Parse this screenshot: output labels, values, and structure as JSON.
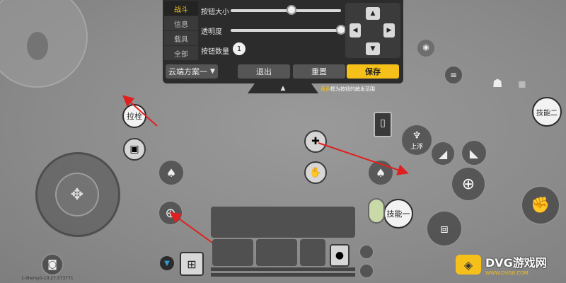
{
  "tabs": [
    {
      "label": "战斗",
      "active": true
    },
    {
      "label": "信息",
      "active": false
    },
    {
      "label": "载具",
      "active": false
    },
    {
      "label": "全部",
      "active": false
    }
  ],
  "settings": {
    "button_size_label": "按钮大小",
    "button_size_value": 0.55,
    "opacity_label": "透明度",
    "opacity_value": 1.0,
    "button_count_label": "按钮数量",
    "button_count_value": "1"
  },
  "scheme_select": "云端方案一",
  "actions": {
    "exit": "退出",
    "reset": "重置",
    "save": "保存"
  },
  "hint": {
    "highlight": "黄色",
    "rest": "框为按钮的触发范围"
  },
  "buttons": {
    "pull_bolt": "拉栓",
    "skill_two": "技能二",
    "skill_one": "技能一",
    "float_up": "上浮"
  },
  "version_text": "1-9lwmy0-10.27.573771",
  "watermark": {
    "title": "DVG游戏网",
    "sub": "WWW.DVG8.COM"
  },
  "colors": {
    "accent_yellow": "#f5c01a",
    "panel_bg": "#2c2c2c",
    "arrow_red": "#e02020"
  }
}
